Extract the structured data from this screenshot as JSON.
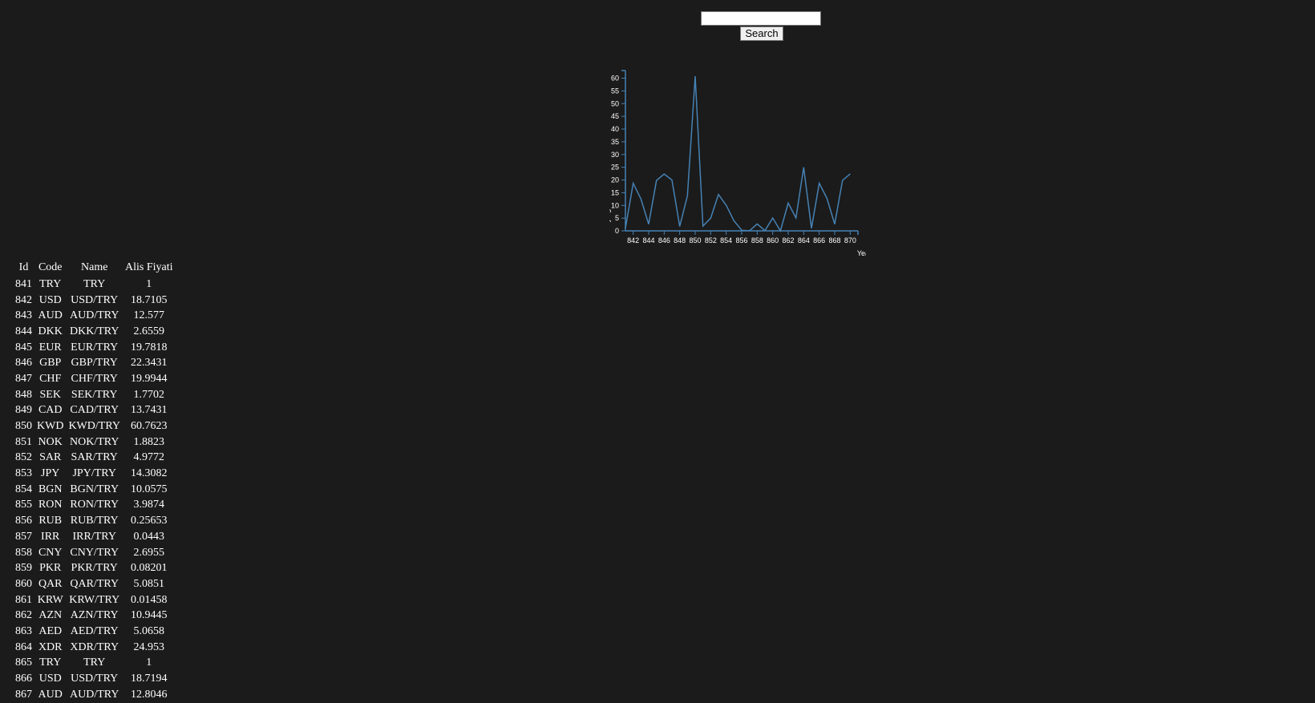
{
  "search": {
    "input_value": "",
    "button_label": "Search"
  },
  "table": {
    "headers": [
      "Id",
      "Code",
      "Name",
      "Alis Fiyati"
    ],
    "rows": [
      [
        "841",
        "TRY",
        "TRY",
        "1"
      ],
      [
        "842",
        "USD",
        "USD/TRY",
        "18.7105"
      ],
      [
        "843",
        "AUD",
        "AUD/TRY",
        "12.577"
      ],
      [
        "844",
        "DKK",
        "DKK/TRY",
        "2.6559"
      ],
      [
        "845",
        "EUR",
        "EUR/TRY",
        "19.7818"
      ],
      [
        "846",
        "GBP",
        "GBP/TRY",
        "22.3431"
      ],
      [
        "847",
        "CHF",
        "CHF/TRY",
        "19.9944"
      ],
      [
        "848",
        "SEK",
        "SEK/TRY",
        "1.7702"
      ],
      [
        "849",
        "CAD",
        "CAD/TRY",
        "13.7431"
      ],
      [
        "850",
        "KWD",
        "KWD/TRY",
        "60.7623"
      ],
      [
        "851",
        "NOK",
        "NOK/TRY",
        "1.8823"
      ],
      [
        "852",
        "SAR",
        "SAR/TRY",
        "4.9772"
      ],
      [
        "853",
        "JPY",
        "JPY/TRY",
        "14.3082"
      ],
      [
        "854",
        "BGN",
        "BGN/TRY",
        "10.0575"
      ],
      [
        "855",
        "RON",
        "RON/TRY",
        "3.9874"
      ],
      [
        "856",
        "RUB",
        "RUB/TRY",
        "0.25653"
      ],
      [
        "857",
        "IRR",
        "IRR/TRY",
        "0.0443"
      ],
      [
        "858",
        "CNY",
        "CNY/TRY",
        "2.6955"
      ],
      [
        "859",
        "PKR",
        "PKR/TRY",
        "0.08201"
      ],
      [
        "860",
        "QAR",
        "QAR/TRY",
        "5.0851"
      ],
      [
        "861",
        "KRW",
        "KRW/TRY",
        "0.01458"
      ],
      [
        "862",
        "AZN",
        "AZN/TRY",
        "10.9445"
      ],
      [
        "863",
        "AED",
        "AED/TRY",
        "5.0658"
      ],
      [
        "864",
        "XDR",
        "XDR/TRY",
        "24.953"
      ],
      [
        "865",
        "TRY",
        "TRY",
        "1"
      ],
      [
        "866",
        "USD",
        "USD/TRY",
        "18.7194"
      ],
      [
        "867",
        "AUD",
        "AUD/TRY",
        "12.8046"
      ]
    ]
  },
  "chart_data": {
    "type": "line",
    "xlabel": "Year",
    "ylabel": "ForexBuying",
    "x_ticks": [
      842,
      844,
      846,
      848,
      850,
      852,
      854,
      856,
      858,
      860,
      862,
      864,
      866,
      868,
      870
    ],
    "y_ticks": [
      0,
      5,
      10,
      15,
      20,
      25,
      30,
      35,
      40,
      45,
      50,
      55,
      60
    ],
    "xlim": [
      841,
      871
    ],
    "ylim": [
      0,
      63
    ],
    "line_color": "#4682b4",
    "x": [
      841,
      842,
      843,
      844,
      845,
      846,
      847,
      848,
      849,
      850,
      851,
      852,
      853,
      854,
      855,
      856,
      857,
      858,
      859,
      860,
      861,
      862,
      863,
      864,
      865,
      866,
      867,
      868,
      869,
      870
    ],
    "y": [
      1,
      18.7105,
      12.577,
      2.6559,
      19.7818,
      22.3431,
      19.9944,
      1.7702,
      13.7431,
      60.7623,
      1.8823,
      4.9772,
      14.3082,
      10.0575,
      3.9874,
      0.25653,
      0.0443,
      2.6955,
      0.08201,
      5.0851,
      0.01458,
      10.9445,
      5.0658,
      24.953,
      1,
      18.7194,
      12.8046,
      2.65,
      19.8,
      22.4
    ]
  }
}
